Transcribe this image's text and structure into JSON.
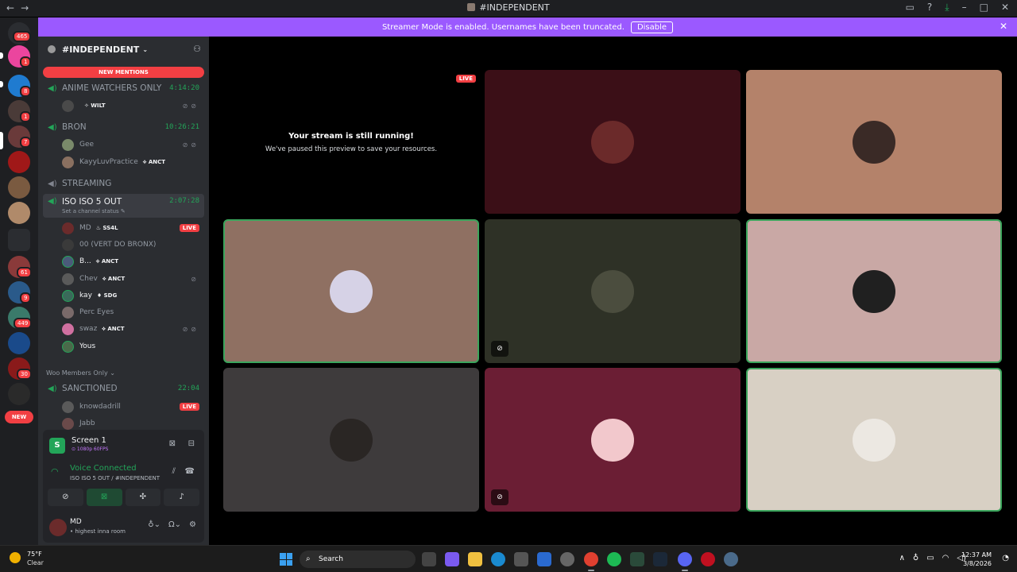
{
  "window": {
    "title": "#INDEPENDENT",
    "nav_back": "←",
    "nav_fwd": "→",
    "controls": [
      "▭",
      "?",
      "⤓",
      "–",
      "□",
      "✕"
    ]
  },
  "banner": {
    "text": "Streamer Mode is enabled. Usernames have been truncated.",
    "button": "Disable",
    "close": "✕"
  },
  "rail": {
    "badges": [
      "465",
      "1",
      "8",
      "1",
      "7",
      "61",
      "9",
      "449",
      "30"
    ],
    "new_label": "NEW"
  },
  "guild": {
    "name": "#INDEPENDENT",
    "chevron": "⌄",
    "add_user_icon": "⚇"
  },
  "new_mentions": "NEW MENTIONS",
  "channels": [
    {
      "name": "ANIME WATCHERS ONLY",
      "time": "4:14:20"
    },
    {
      "name": "BRON",
      "time": "10:26:21"
    },
    {
      "name": "STREAMING",
      "time": ""
    },
    {
      "name": "ISO ISO 5 OUT",
      "time": "2:07:28",
      "status": "Set a channel status ✎"
    },
    {
      "name": "SANCTIONED",
      "time": "22:04"
    }
  ],
  "members": {
    "anime": [
      {
        "name": "",
        "tag": "✧ WILT"
      }
    ],
    "bron": [
      {
        "name": "Gee",
        "tag": ""
      },
      {
        "name": "KayyLuvPractice",
        "tag": "⟡ ANCT"
      }
    ],
    "iso": [
      {
        "name": "MD",
        "tag": "♨ SS4L",
        "live": "LIVE"
      },
      {
        "name": "00 (VERT DO BRONX)",
        "tag": ""
      },
      {
        "name": "B...",
        "tag": "⟡ ANCT"
      },
      {
        "name": "Chev",
        "tag": "⟡ ANCT"
      },
      {
        "name": "kay",
        "tag": "♦ SDG"
      },
      {
        "name": "Perc Eyes",
        "tag": ""
      },
      {
        "name": "swaz",
        "tag": "⟡ ANCT"
      },
      {
        "name": "Yous",
        "tag": ""
      }
    ],
    "sanctioned": [
      {
        "name": "knowdadrill",
        "live": "LIVE"
      },
      {
        "name": "Jabb"
      }
    ]
  },
  "category_woo": "Woo Members Only ⌄",
  "panel": {
    "screen_title": "Screen 1",
    "screen_sub": "⊙ 1080p 60FPS",
    "voice_title": "Voice Connected",
    "voice_sub": "ISO ISO 5 OUT / #INDEPENDENT",
    "user_name": "MD",
    "user_status": "• highest inna room",
    "screen_letter": "S"
  },
  "stage": {
    "paused_title": "Your stream is still running!",
    "paused_sub": "We've paused this preview to save your resources.",
    "live_label": "LIVE",
    "tile_colors": [
      "#3b0f17",
      "#b4826a",
      "#8f7062",
      "#2e3126",
      "#c9a8a5",
      "#3e3b3c",
      "#6b1e34",
      "#d8d0c4"
    ],
    "avatar_colors": [
      "#6b2a2a",
      "#3a2a26",
      "#d6d2e6",
      "#4b4d3e",
      "#202020",
      "#2a2624",
      "#f2c8cc",
      "#ece8e2"
    ]
  },
  "taskbar": {
    "temp": "75°F",
    "cond": "Clear",
    "search": "Search",
    "time": "12:37 AM",
    "date": "3/8/2026"
  }
}
